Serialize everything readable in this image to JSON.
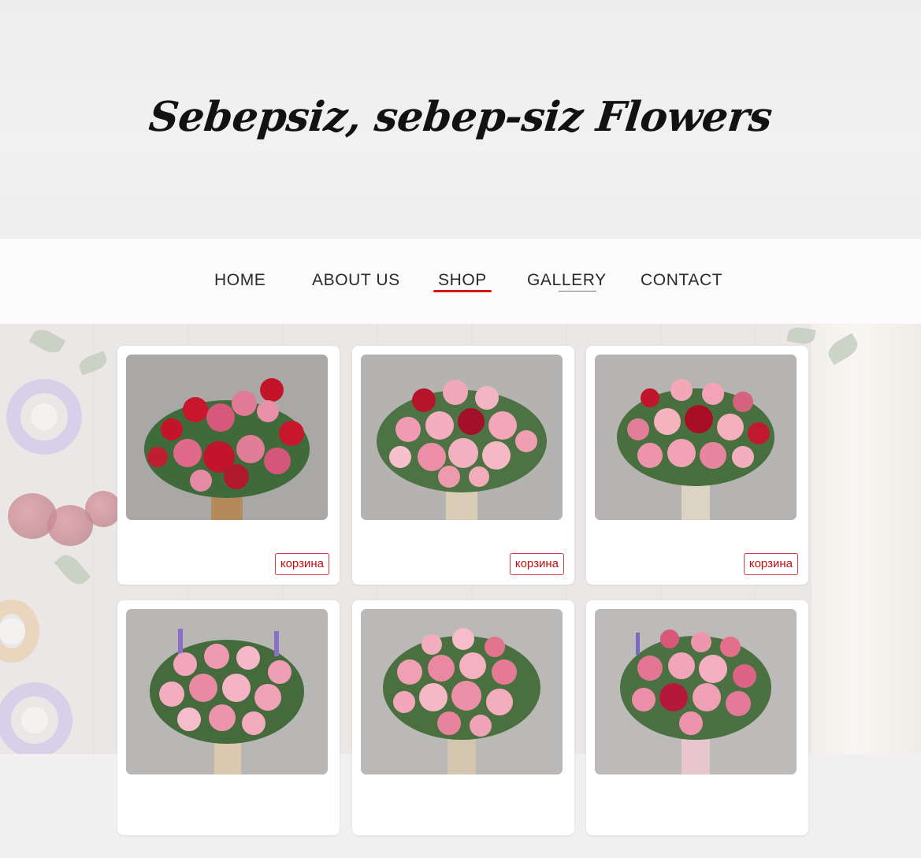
{
  "header": {
    "site_title": "Sebepsiz, sebep-siz Flowers"
  },
  "nav": {
    "items": [
      {
        "label": "HOME"
      },
      {
        "label": "ABOUT US"
      },
      {
        "label": "SHOP"
      },
      {
        "label": "GALLERY"
      },
      {
        "label": "CONTACT"
      }
    ],
    "active": "SHOP",
    "accent_color": "#d9161a"
  },
  "products": [
    {
      "image": "red-and-pink-roses-bouquet-photo",
      "cart_label": "корзина"
    },
    {
      "image": "pink-roses-and-carnations-bouquet-photo",
      "cart_label": "корзина"
    },
    {
      "image": "pink-and-red-roses-bouquet-photo",
      "cart_label": "корзина"
    },
    {
      "image": "pink-roses-lavender-bouquet-photo",
      "cart_label": ""
    },
    {
      "image": "pink-carnations-roses-bouquet-photo",
      "cart_label": ""
    },
    {
      "image": "pink-roses-carnations-ribbon-bouquet-photo",
      "cart_label": ""
    }
  ],
  "colors": {
    "cart_button_text": "#c40d10",
    "card_background": "#ffffff"
  }
}
